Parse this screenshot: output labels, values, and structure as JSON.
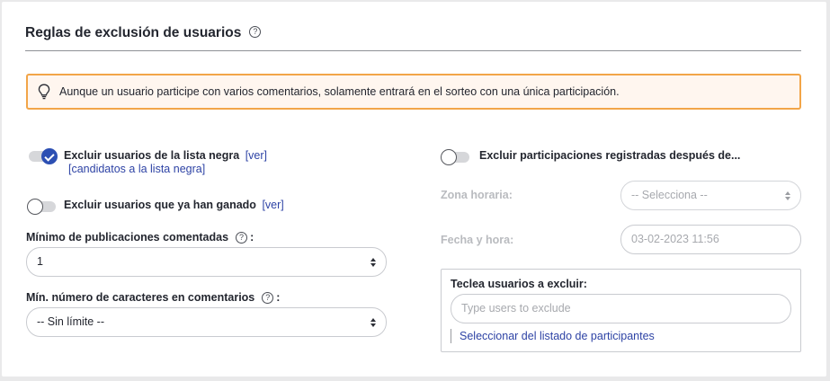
{
  "section": {
    "title": "Reglas de exclusión de usuarios",
    "help_glyph": "?"
  },
  "alert": {
    "icon": "lightbulb-icon",
    "text": "Aunque un usuario participe con varios comentarios, solamente entrará en el sorteo con una única participación."
  },
  "left": {
    "blacklist": {
      "label": "Excluir usuarios de la lista negra",
      "enabled": true,
      "view_link": "[ver]",
      "candidates_link": "[candidatos a la lista negra]"
    },
    "winners": {
      "label": "Excluir usuarios que ya han ganado",
      "enabled": false,
      "view_link": "[ver]"
    },
    "min_posts": {
      "label": "Mínimo de publicaciones comentadas",
      "help_glyph": "?",
      "suffix": ":",
      "value": "1"
    },
    "min_chars": {
      "label": "Mín. número de caracteres en comentarios",
      "help_glyph": "?",
      "suffix": ":",
      "value": "-- Sin límite --"
    }
  },
  "right": {
    "after_date": {
      "label": "Excluir participaciones registradas después de...",
      "enabled": false
    },
    "timezone": {
      "label": "Zona horaria:",
      "value": "-- Selecciona --"
    },
    "datetime": {
      "label": "Fecha y hora:",
      "placeholder": "03-02-2023 11:56"
    },
    "exclude_users": {
      "title": "Teclea usuarios a excluir:",
      "placeholder": "Type users to exclude",
      "pick_link": "Seleccionar del listado de participantes"
    }
  },
  "colors": {
    "accent": "#2c4fb3",
    "link": "#2e43a5",
    "alert_border": "#f2a548",
    "alert_bg": "#fff6ef"
  }
}
